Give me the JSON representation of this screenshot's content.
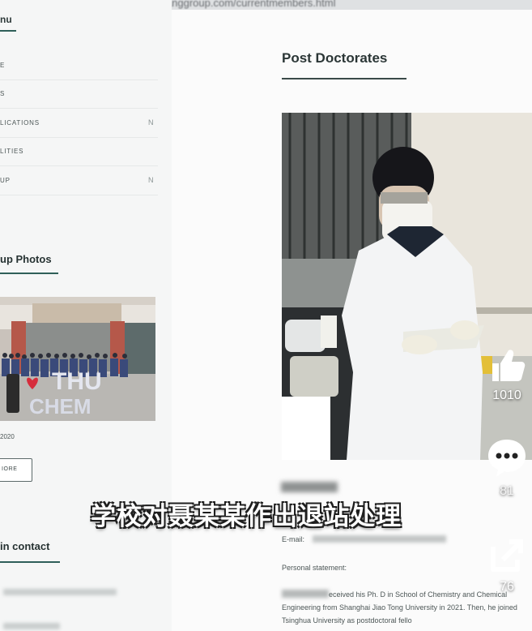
{
  "browser": {
    "url": "thuwanglianggroup.com/currentmembers.html"
  },
  "sidebar": {
    "header": "nu",
    "nav": [
      {
        "label": "E",
        "chevron": ""
      },
      {
        "label": "S",
        "chevron": ""
      },
      {
        "label": "LICATIONS",
        "chevron": "N"
      },
      {
        "label": "LITIES",
        "chevron": ""
      },
      {
        "label": "UP",
        "chevron": "N"
      }
    ],
    "group_photos_title": "up Photos",
    "photo_text": {
      "thu": "THU",
      "chem": "CHEM"
    },
    "photo_caption": "2020",
    "more_button": "IORE",
    "contact_title": "in contact"
  },
  "main": {
    "title": "Post Doctorates",
    "email_label": "E-mail:",
    "statement_label": "Personal statement:",
    "statement_text": "eceived his Ph. D in School of Chemistry and Chemical Engineering from Shanghai Jiao Tong University in 2021. Then, he joined Tsinghua University as postdoctoral fello"
  },
  "video": {
    "subtitle": "学校对聂某某作出退站处理",
    "likes": "1010",
    "comments": "81",
    "shares": "76"
  },
  "colors": {
    "accent": "#2f5f59",
    "background": "#fbfbfb",
    "sidebar": "#f5f6f6"
  },
  "icons": [
    "back-arrow-icon",
    "lock-icon",
    "chevron-icon",
    "thumbs-up-icon",
    "comment-bubble-icon",
    "share-icon"
  ]
}
